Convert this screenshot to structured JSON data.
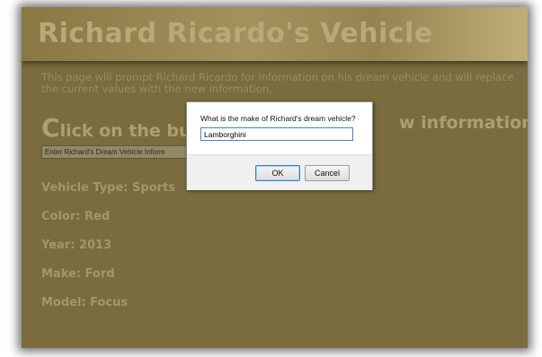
{
  "page": {
    "title": "Richard Ricardo's Vehicle",
    "intro": "This page will prompt Richard Ricardo for information on his dream vehicle and will replace the current values with the new information.",
    "subhead_first": "C",
    "subhead_rest": "lick on the but",
    "subhead_tail": "w information",
    "enter_button_label": "Enter Richard's Dream Vehicle Inform",
    "specs": [
      "Vehicle Type: Sports",
      "Color: Red",
      "Year: 2013",
      "Make: Ford",
      "Model: Focus"
    ]
  },
  "dialog": {
    "prompt": "What is the make of Richard's dream vehicle?",
    "input_value": "Lamborghini",
    "ok_label": "OK",
    "cancel_label": "Cancel"
  }
}
